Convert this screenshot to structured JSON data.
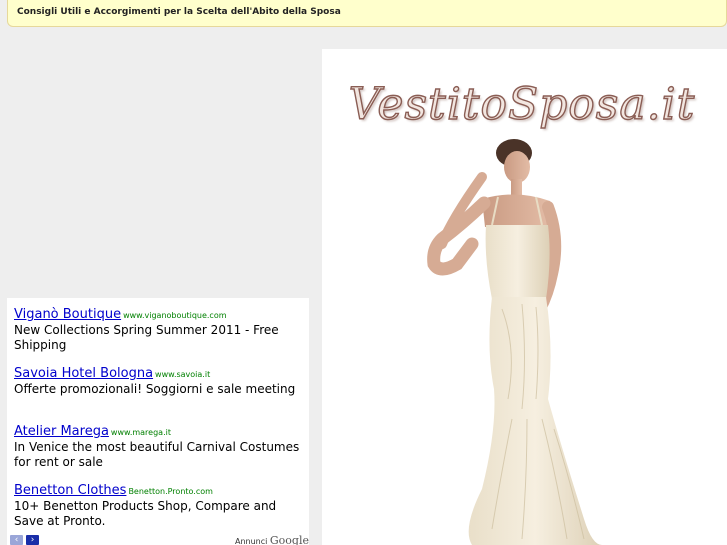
{
  "topbar": {
    "title": "Consigli Utili e Accorgimenti per la Scelta dell'Abito della Sposa"
  },
  "logo": {
    "text": "VestitoSposa.it"
  },
  "ads": [
    {
      "title": "Viganò Boutique",
      "url": "www.viganoboutique.com",
      "text": "New Collections Spring Summer 2011 - Free Shipping"
    },
    {
      "title": "Savoia Hotel Bologna",
      "url": "www.savoia.it",
      "text": "Offerte promozionali! Soggiorni e sale meeting"
    },
    {
      "title": "Atelier Marega",
      "url": "www.marega.it",
      "text": "In Venice the most beautiful Carnival Costumes for rent or sale"
    },
    {
      "title": "Benetton Clothes",
      "url": "Benetton.Pronto.com",
      "text": "10+ Benetton Products Shop, Compare and Save at Pronto."
    }
  ],
  "adfooter": {
    "label": "Annunci",
    "brand": "Google",
    "prev_icon": "chevron-left-icon",
    "next_icon": "chevron-right-icon"
  },
  "colors": {
    "topbar_bg": "#ffffcc",
    "ad_link": "#0000cc",
    "ad_url": "#008000"
  }
}
